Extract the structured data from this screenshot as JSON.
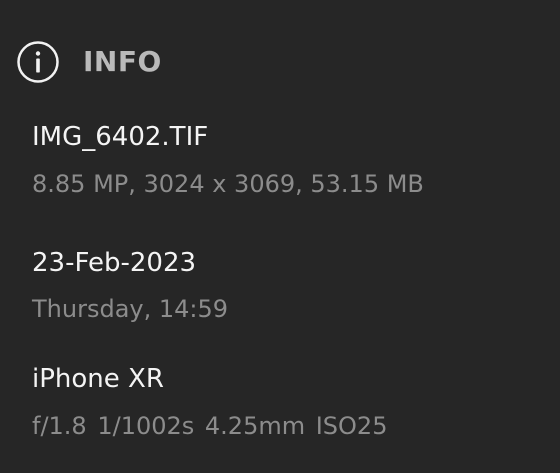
{
  "header": {
    "title": "INFO",
    "icon": "info-icon"
  },
  "file": {
    "name": "IMG_6402.TIF",
    "details": "8.85 MP, 3024 x 3069, 53.15 MB"
  },
  "capture": {
    "date": "23-Feb-2023",
    "weekday_time": "Thursday, 14:59"
  },
  "camera": {
    "model": "iPhone XR",
    "exposure": "f/1.8  1/1002s  4.25mm  ISO25"
  },
  "colors": {
    "background": "#262626",
    "primary_text": "#f4f4f4",
    "secondary_text": "#8c8c8c",
    "header_text": "#b9b9b9"
  }
}
